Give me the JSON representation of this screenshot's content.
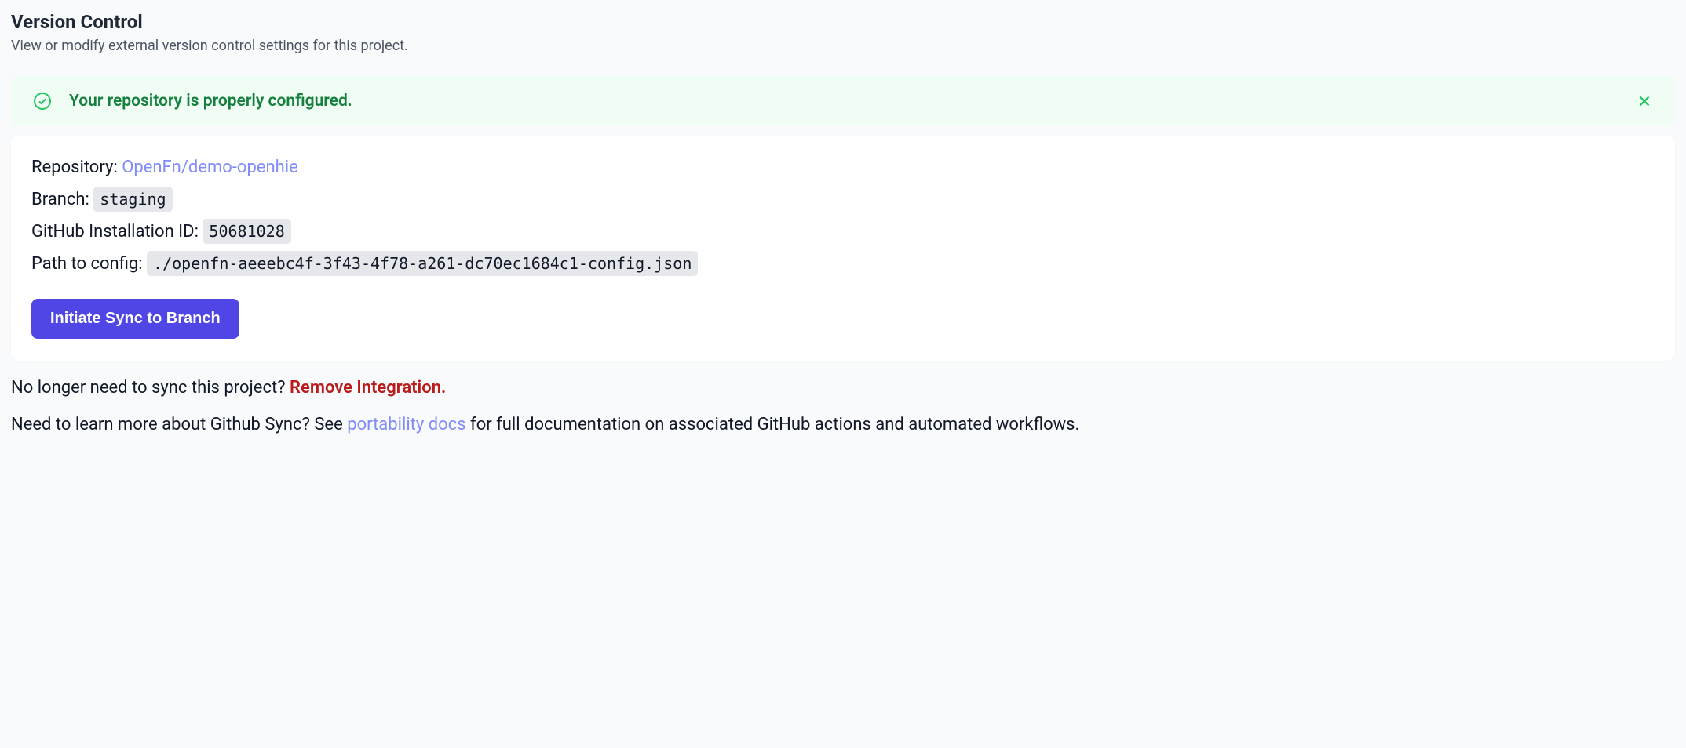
{
  "header": {
    "title": "Version Control",
    "subtitle": "View or modify external version control settings for this project."
  },
  "alert": {
    "message": "Your repository is properly configured."
  },
  "repo": {
    "label": "Repository:",
    "link_text": "OpenFn/demo-openhie"
  },
  "branch": {
    "label": "Branch:",
    "value": "staging"
  },
  "installation": {
    "label": "GitHub Installation ID:",
    "value": "50681028"
  },
  "config_path": {
    "label": "Path to config:",
    "value": "./openfn-aeeebc4f-3f43-4f78-a261-dc70ec1684c1-config.json"
  },
  "sync_button_label": "Initiate Sync to Branch",
  "remove": {
    "prefix": "No longer need to sync this project? ",
    "link": "Remove Integration."
  },
  "docs": {
    "prefix": "Need to learn more about Github Sync? See ",
    "link": "portability docs",
    "suffix": " for full documentation on associated GitHub actions and automated workflows."
  }
}
